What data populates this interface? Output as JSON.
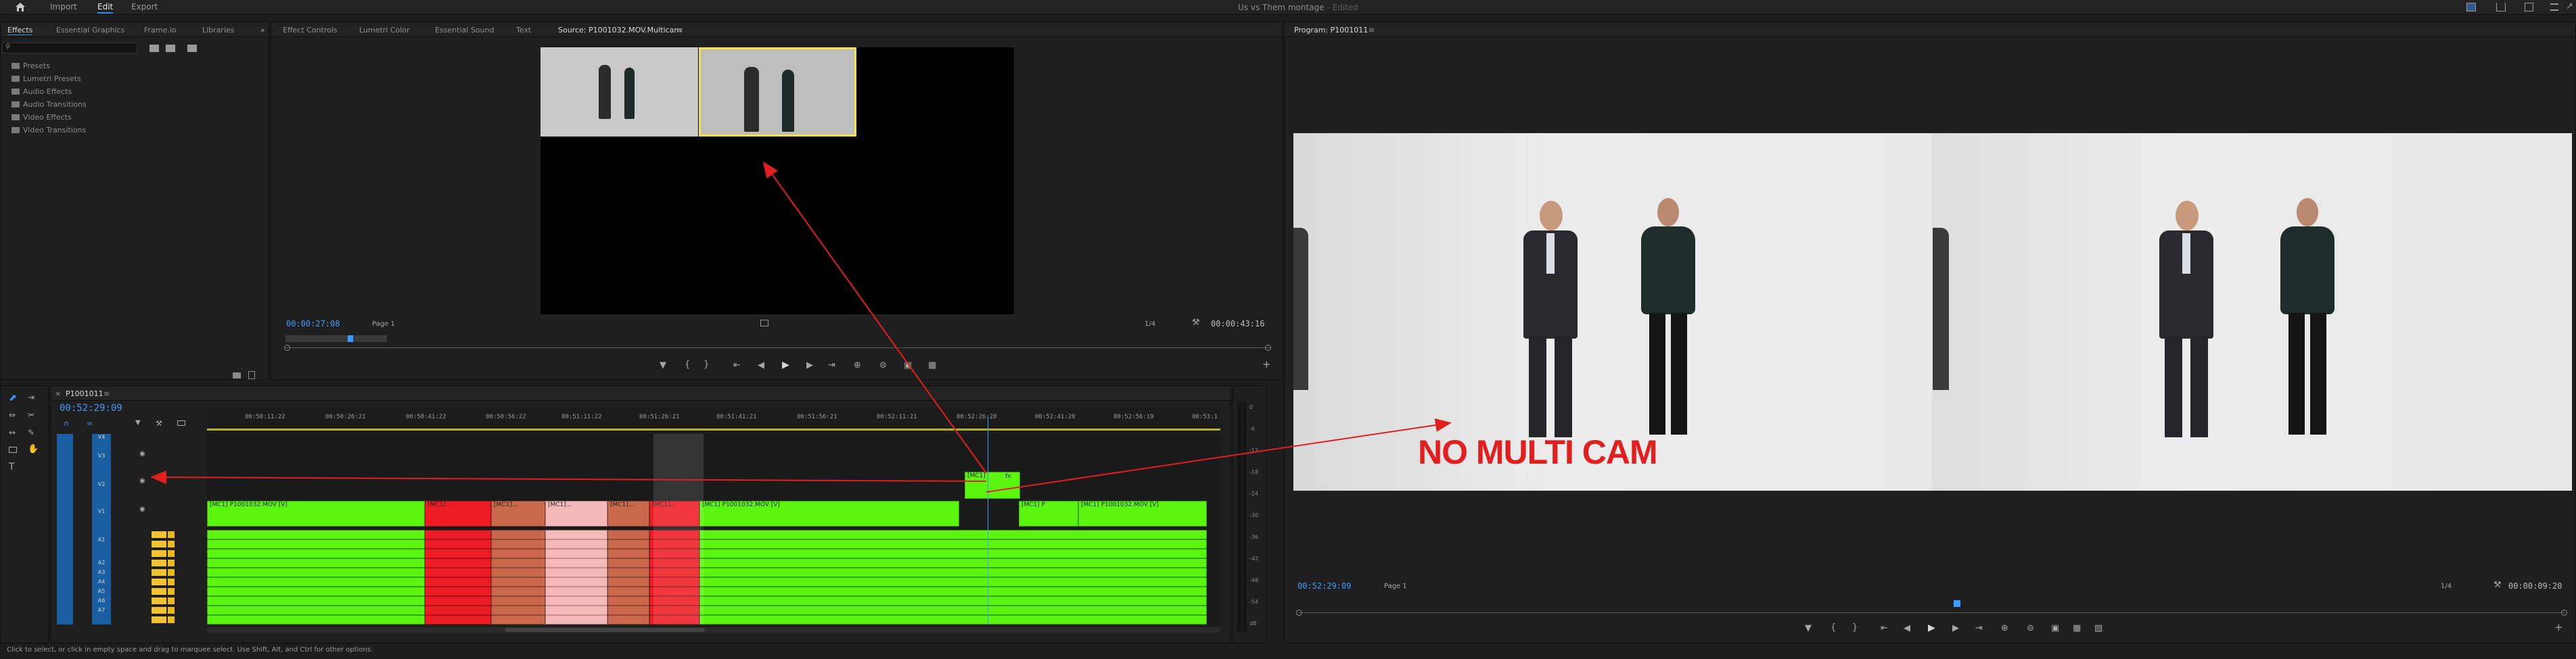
{
  "topbar": {
    "workspaces": [
      "Import",
      "Edit",
      "Export"
    ],
    "active_workspace": "Edit",
    "document_title": "Us vs Them montage",
    "document_status": "- Edited"
  },
  "effects_panel": {
    "tabs": [
      "Effects",
      "Essential Graphics",
      "Frame.io",
      "Libraries"
    ],
    "active_tab": "Effects",
    "tree": [
      "Presets",
      "Lumetri Presets",
      "Audio Effects",
      "Audio Transitions",
      "Video Effects",
      "Video Transitions"
    ]
  },
  "source_monitor": {
    "tabs": [
      "Effect Controls",
      "Lumetri Color",
      "Essential Sound",
      "Text",
      "Source: P1001032.MOV.Multicam"
    ],
    "active_tab": "Source: P1001032.MOV.Multicam",
    "timecode": "00:00:27:08",
    "page": "Page 1",
    "zoom": "1/4",
    "duration": "00:00:43:16"
  },
  "program_monitor": {
    "title": "Program: P1001011",
    "timecode": "00:52:29:09",
    "page": "Page 1",
    "zoom": "1/4",
    "duration": "00:00:09:20"
  },
  "timeline": {
    "sequence_name": "P1001011",
    "timecode": "00:52:29:09",
    "ruler": [
      "00:50:11:22",
      "00:50:26:21",
      "00:50:41:22",
      "00:50:56:22",
      "00:51:11:22",
      "00:51:26:21",
      "00:51:41:21",
      "00:51:56:21",
      "00:52:11:21",
      "00:52:26:20",
      "00:52:41:20",
      "00:52:56:19",
      "00:53:1"
    ],
    "video_tracks": [
      "V4",
      "V3",
      "V2",
      "V1"
    ],
    "audio_tracks": [
      "A1",
      "A2",
      "A3",
      "A4",
      "A5",
      "A6",
      "A7"
    ],
    "clip_labels": {
      "main": "[MC1] P1001032.MOV [V]",
      "short": "[MC1] P1001032.MOV [V]",
      "tiny1": "[MC1]...",
      "tiny2": "[MC1] P",
      "v2clip": "[MC1]",
      "fx": "fx"
    },
    "meter_scale": [
      "0",
      "-6",
      "-12",
      "-18",
      "-24",
      "-30",
      "-36",
      "-42",
      "-48",
      "-54",
      "dB"
    ]
  },
  "annotation": {
    "text": "NO MULTI CAM"
  },
  "status_bar": {
    "text": "Click to select, or click in empty space and drag to marquee select. Use Shift, Alt, and Ctrl for other options."
  },
  "colors": {
    "accent_blue": "#3c9bff",
    "clip_green": "#5cf510",
    "clip_red": "#ee1c24",
    "clip_brown": "#c9684a",
    "clip_pink": "#f5b9b9",
    "annotation_red": "#e31e1e"
  }
}
